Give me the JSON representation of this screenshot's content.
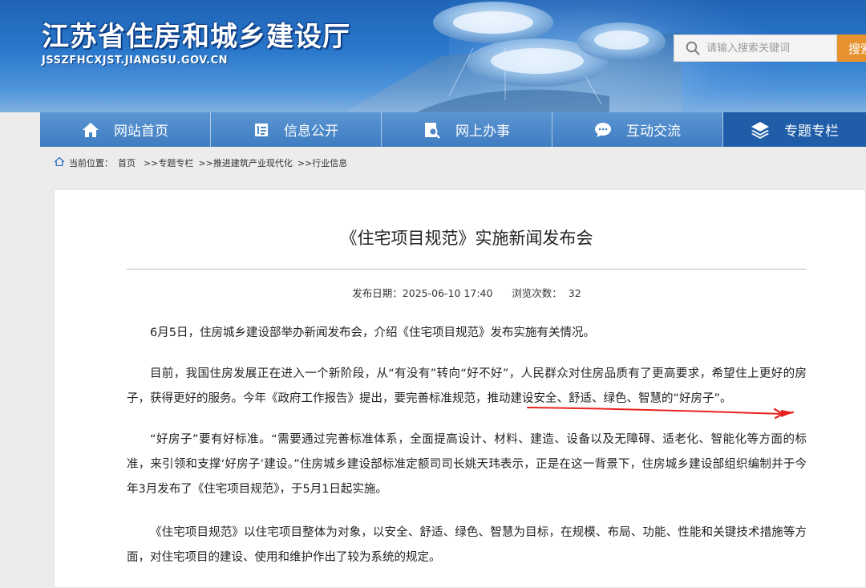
{
  "header": {
    "site_title": "江苏省住房和城乡建设厅",
    "site_url": "JSSZFHCXJST.JIANGSU.GOV.CN",
    "search_placeholder": "请输入搜索关键词",
    "search_button": "搜索",
    "search_icon": "search-icon"
  },
  "nav": {
    "items": [
      {
        "label": "网站首页",
        "icon": "home-icon"
      },
      {
        "label": "信息公开",
        "icon": "document-icon"
      },
      {
        "label": "网上办事",
        "icon": "search-doc-icon"
      },
      {
        "label": "互动交流",
        "icon": "chat-icon"
      },
      {
        "label": "专题专栏",
        "icon": "layers-icon"
      }
    ],
    "active_index": 4
  },
  "breadcrumb": {
    "icon": "home-icon",
    "prefix": "当前位置：",
    "items": [
      "首页",
      ">>专题专栏",
      ">>推进建筑产业现代化",
      ">>行业信息"
    ]
  },
  "article": {
    "title": "《住宅项目规范》实施新闻发布会",
    "publish_label": "发布日期：",
    "publish_date": "2025-06-10 17:40",
    "views_label": "浏览次数：",
    "views": "32",
    "paragraphs": [
      "6月5日，住房城乡建设部举办新闻发布会，介绍《住宅项目规范》发布实施有关情况。",
      "目前，我国住房发展正在进入一个新阶段，从“有没有”转向“好不好”，人民群众对住房品质有了更高要求，希望住上更好的房子，获得更好的服务。今年《政府工作报告》提出，要完善标准规范，",
      "“好房子”要有好标准。“需要通过完善标准体系，全面提高设计、材料、建造、设备以及无障碍、适老化、智能化等方面的标准，来引领和支撑‘好房子’建设。”住房城乡建设部标准定额司司长姚天玮表示，正是在这一背景下，住房城乡建设部组织编制并于今年3月发布了《住宅项目规范》，于5月1日起实施。",
      "《住宅项目规范》以住宅项目整体为对象，以安全、舒适、绿色、智慧为目标，在规模、布局、功能、性能和关键技术措施等方面，对住宅项目的建设、使用和维护作出了较为系统的规定。"
    ],
    "highlight": "推动建设安全、舒适、绿色、智慧的“好房子”。",
    "annotation_color": "#e8231f"
  }
}
